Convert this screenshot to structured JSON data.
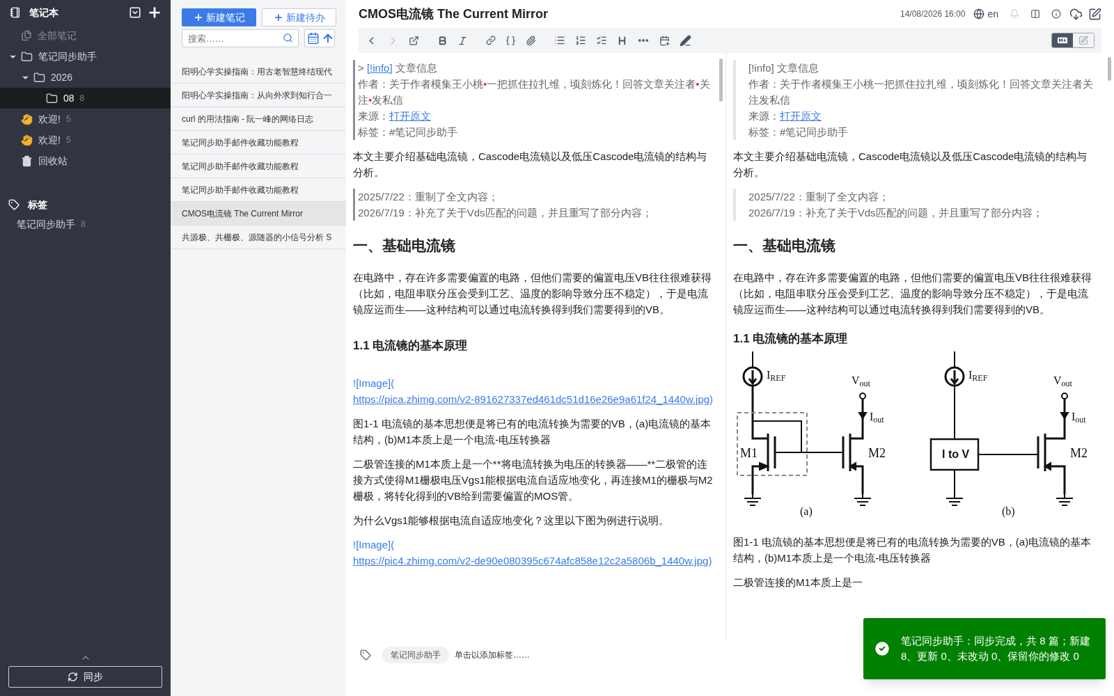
{
  "sidebar": {
    "title": "笔记本",
    "notebooks": [
      {
        "label": "全部笔记",
        "kind": "all",
        "selected": false
      },
      {
        "label": "笔记同步助手",
        "kind": "folder",
        "selected": false,
        "expanded": true,
        "children": [
          {
            "label": "2026",
            "kind": "folder",
            "selected": false,
            "expanded": true,
            "children": [
              {
                "label": "08",
                "kind": "folder",
                "count": "8",
                "selected": true
              }
            ]
          }
        ]
      },
      {
        "label": "欢迎!",
        "kind": "wave",
        "count": "5",
        "selected": false
      },
      {
        "label": "欢迎!",
        "kind": "wave",
        "count": "5",
        "selected": false
      },
      {
        "label": "回收站",
        "kind": "trash",
        "selected": false
      }
    ],
    "tags_title": "标签",
    "tags": [
      {
        "label": "笔记同步助手",
        "count": "8"
      }
    ],
    "sync_button": "同步"
  },
  "note_list": {
    "new_note": "新建笔记",
    "new_todo": "新建待办",
    "search": {
      "placeholder": "搜索……"
    },
    "notes": [
      {
        "title": "阳明心学实操指南：用古老智慧终结现代",
        "selected": false
      },
      {
        "title": "阳明心学实操指南：从向外求到知行合一",
        "selected": false
      },
      {
        "title": "curl 的用法指南 - 阮一峰的网络日志",
        "selected": false
      },
      {
        "title": "笔记同步助手邮件收藏功能教程",
        "selected": false
      },
      {
        "title": "笔记同步助手邮件收藏功能教程",
        "selected": false
      },
      {
        "title": "笔记同步助手邮件收藏功能教程",
        "selected": false
      },
      {
        "title": "CMOS电流镜 The Current Mirror",
        "selected": true
      },
      {
        "title": "共源极、共栅极、源随器的小信号分析 S",
        "selected": false
      }
    ]
  },
  "editor": {
    "title": "CMOS电流镜 The Current Mirror",
    "datetime": "14/08/2026 16:00",
    "language": "en",
    "view_modes": [
      {
        "kind": "markdown",
        "selected": true
      },
      {
        "kind": "edit",
        "selected": false
      }
    ],
    "source": [
      {
        "kind": "quote",
        "lines": [
          [
            {
              "text": "> ",
              "kind": "plain"
            },
            {
              "text": "[!info]",
              "kind": "link"
            },
            {
              "text": " 文章信息",
              "kind": "plain"
            }
          ],
          [
            {
              "text": "作者：关于作者模集王小桃",
              "kind": "plain"
            },
            {
              "text": "•",
              "kind": "dot"
            },
            {
              "text": "一把抓住拉扎维，顷刻炼化！回答文章关注者",
              "kind": "plain"
            },
            {
              "text": "•",
              "kind": "dot"
            },
            {
              "text": "关注",
              "kind": "plain"
            },
            {
              "text": "•",
              "kind": "dot"
            },
            {
              "text": "发私信",
              "kind": "plain"
            }
          ],
          [
            {
              "text": "来源：",
              "kind": "plain"
            },
            {
              "text": "打开原文",
              "kind": "link"
            }
          ],
          [
            {
              "text": "标签：#笔记同步助手",
              "kind": "plain"
            }
          ]
        ]
      },
      {
        "kind": "para",
        "segments": [
          {
            "text": "本文主要介绍基础电流镜，Cascode电流镜以及低压Cascode电流镜的结构与分析。",
            "kind": "plain"
          }
        ]
      },
      {
        "kind": "quote",
        "lines": [
          [
            {
              "text": "2025/7/22：重制了全文内容；",
              "kind": "plain"
            }
          ],
          [
            {
              "text": "2026/7/19：补充了关于Vds匹配的问题，并且重写了部分内容；",
              "kind": "plain"
            }
          ]
        ]
      },
      {
        "kind": "h1",
        "text": "一、基础电流镜"
      },
      {
        "kind": "para",
        "segments": [
          {
            "text": "在电路中，存在许多需要偏置的电路，但他们需要的偏置电压VB往往很难获得（比如，电阻串联分压会受到工艺、温度的影响导致分压不稳定），于是电流镜应运而生——这种结构可以通过电流转换得到我们需要得到的VB。",
            "kind": "plain"
          }
        ]
      },
      {
        "kind": "h2",
        "text": "1.1 电流镜的基本原理"
      },
      {
        "kind": "para",
        "segments": [
          {
            "text": "![Image](",
            "kind": "syntax"
          },
          {
            "text": "https://pica.zhimg.com/v2-891627337ed461dc51d16e26e9a61f24_1440w.jpg",
            "kind": "link"
          },
          {
            "text": ")",
            "kind": "syntax"
          }
        ]
      },
      {
        "kind": "para",
        "segments": [
          {
            "text": "图1-1 电流镜的基本思想便是将已有的电流转换为需要的VB，(a)电流镜的基本结构，(b)M1本质上是一个电流-电压转换器",
            "kind": "plain"
          }
        ]
      },
      {
        "kind": "para",
        "segments": [
          {
            "text": "二极管连接的M1本质上是一个**将电流转换为电压的转换器——**二极管的连接方式使得M1栅极电压Vgs1能根据电流自适应地变化，再连接M1的栅极与M2栅极，将转化得到的VB给到需要偏置的MOS管。",
            "kind": "plain"
          }
        ]
      },
      {
        "kind": "para",
        "segments": [
          {
            "text": "为什么Vgs1能够根据电流自适应地变化？这里以下图为例进行说明。",
            "kind": "plain"
          }
        ]
      },
      {
        "kind": "para",
        "segments": [
          {
            "text": "![Image](",
            "kind": "syntax"
          },
          {
            "text": "https://pic4.zhimg.com/v2-de90e080395c674afc858e12c2a5806b_1440w.jpg",
            "kind": "link"
          },
          {
            "text": ")",
            "kind": "syntax"
          }
        ]
      }
    ],
    "preview": [
      {
        "kind": "quote",
        "lines": [
          [
            {
              "text": "[!info] 文章信息",
              "kind": "plain"
            }
          ],
          [
            {
              "text": "作者：关于作者模集王小桃一把抓住拉扎维，顷刻炼化！回答文章关注者关注发私信",
              "kind": "plain"
            }
          ],
          [
            {
              "text": "来源：",
              "kind": "plain"
            },
            {
              "text": "打开原文",
              "kind": "link"
            }
          ],
          [
            {
              "text": "标签：#笔记同步助手",
              "kind": "plain"
            }
          ]
        ]
      },
      {
        "kind": "para",
        "segments": [
          {
            "text": "本文主要介绍基础电流镜，Cascode电流镜以及低压Cascode电流镜的结构与分析。",
            "kind": "plain"
          }
        ]
      },
      {
        "kind": "quote",
        "lines": [
          [
            {
              "text": "2025/7/22：重制了全文内容；",
              "kind": "plain"
            }
          ],
          [
            {
              "text": "2026/7/19：补充了关于Vds匹配的问题，并且重写了部分内容；",
              "kind": "plain"
            }
          ]
        ]
      },
      {
        "kind": "h1",
        "text": "一、基础电流镜"
      },
      {
        "kind": "para",
        "segments": [
          {
            "text": "在电路中，存在许多需要偏置的电路，但他们需要的偏置电压VB往往很难获得（比如，电阻串联分压会受到工艺、温度的影响导致分压不稳定），于是电流镜应运而生——这种结构可以通过电流转换得到我们需要得到的VB。",
            "kind": "plain"
          }
        ]
      },
      {
        "kind": "h2",
        "text": "1.1 电流镜的基本原理"
      },
      {
        "kind": "figure",
        "panels": [
          {
            "kind": "mirror",
            "iref": "I$_{REF}$",
            "vout": "V$_{out}$",
            "iout": "I$_{out}$",
            "m1": "M1",
            "m2": "M2",
            "caption": "(a)"
          },
          {
            "kind": "converter",
            "iref": "I$_{REF}$",
            "vout": "V$_{out}$",
            "iout": "I$_{out}$",
            "block": "I to V",
            "m2": "M2",
            "caption": "(b)"
          }
        ]
      },
      {
        "kind": "para",
        "segments": [
          {
            "text": "图1-1 电流镜的基本思想便是将已有的电流转换为需要的VB，(a)电流镜的基本结构，(b)M1本质上是一个电流-电压转换器",
            "kind": "plain"
          }
        ]
      },
      {
        "kind": "para",
        "segments": [
          {
            "text": "二极管连接的M1本质上是一",
            "kind": "plain"
          }
        ]
      }
    ],
    "tags": [
      "笔记同步助手"
    ],
    "tag_input": {
      "placeholder": "单击以添加标签……"
    }
  },
  "toast": {
    "kind": "success",
    "text": "笔记同步助手：同步完成，共 8 篇；新建 8、更新 0、未改动 0、保留你的修改 0"
  }
}
